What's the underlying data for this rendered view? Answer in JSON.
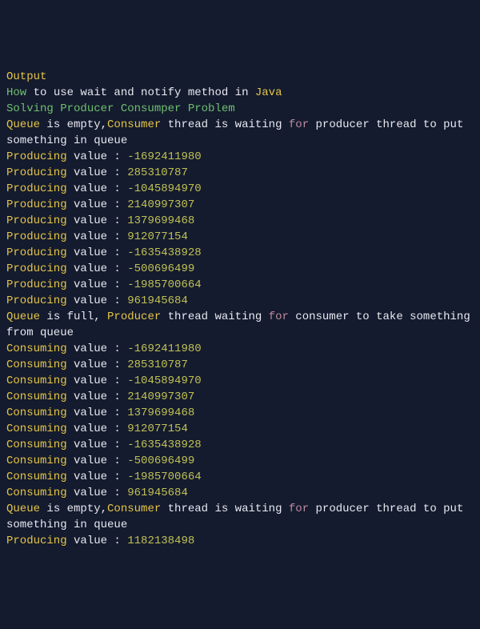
{
  "lines": [
    {
      "tokens": [
        {
          "t": "Output",
          "c": "kw"
        }
      ]
    },
    {
      "tokens": [
        {
          "t": "How",
          "c": "ty"
        },
        {
          "t": " to use wait and notify method in ",
          "c": "txt"
        },
        {
          "t": "Java",
          "c": "fn"
        }
      ]
    },
    {
      "tokens": [
        {
          "t": "Solving Producer Consumper Problem",
          "c": "ty"
        }
      ]
    },
    {
      "tokens": [
        {
          "t": "Queue",
          "c": "kw"
        },
        {
          "t": " is empty,",
          "c": "txt"
        },
        {
          "t": "Consumer",
          "c": "kw"
        },
        {
          "t": " thread is waiting ",
          "c": "txt"
        },
        {
          "t": "for",
          "c": "op"
        },
        {
          "t": " producer thread to put something in queue",
          "c": "txt"
        }
      ]
    },
    {
      "tokens": [
        {
          "t": "Producing",
          "c": "kw"
        },
        {
          "t": " value : ",
          "c": "txt"
        },
        {
          "t": "-1692411980",
          "c": "num"
        }
      ]
    },
    {
      "tokens": [
        {
          "t": "Producing",
          "c": "kw"
        },
        {
          "t": " value : ",
          "c": "txt"
        },
        {
          "t": "285310787",
          "c": "num"
        }
      ]
    },
    {
      "tokens": [
        {
          "t": "Producing",
          "c": "kw"
        },
        {
          "t": " value : ",
          "c": "txt"
        },
        {
          "t": "-1045894970",
          "c": "num"
        }
      ]
    },
    {
      "tokens": [
        {
          "t": "Producing",
          "c": "kw"
        },
        {
          "t": " value : ",
          "c": "txt"
        },
        {
          "t": "2140997307",
          "c": "num"
        }
      ]
    },
    {
      "tokens": [
        {
          "t": "Producing",
          "c": "kw"
        },
        {
          "t": " value : ",
          "c": "txt"
        },
        {
          "t": "1379699468",
          "c": "num"
        }
      ]
    },
    {
      "tokens": [
        {
          "t": "Producing",
          "c": "kw"
        },
        {
          "t": " value : ",
          "c": "txt"
        },
        {
          "t": "912077154",
          "c": "num"
        }
      ]
    },
    {
      "tokens": [
        {
          "t": "Producing",
          "c": "kw"
        },
        {
          "t": " value : ",
          "c": "txt"
        },
        {
          "t": "-1635438928",
          "c": "num"
        }
      ]
    },
    {
      "tokens": [
        {
          "t": "Producing",
          "c": "kw"
        },
        {
          "t": " value : ",
          "c": "txt"
        },
        {
          "t": "-500696499",
          "c": "num"
        }
      ]
    },
    {
      "tokens": [
        {
          "t": "Producing",
          "c": "kw"
        },
        {
          "t": " value : ",
          "c": "txt"
        },
        {
          "t": "-1985700664",
          "c": "num"
        }
      ]
    },
    {
      "tokens": [
        {
          "t": "Producing",
          "c": "kw"
        },
        {
          "t": " value : ",
          "c": "txt"
        },
        {
          "t": "961945684",
          "c": "num"
        }
      ]
    },
    {
      "tokens": [
        {
          "t": "Queue",
          "c": "kw"
        },
        {
          "t": " is full, ",
          "c": "txt"
        },
        {
          "t": "Producer",
          "c": "kw"
        },
        {
          "t": " thread waiting ",
          "c": "txt"
        },
        {
          "t": "for",
          "c": "op"
        },
        {
          "t": " consumer to take something from queue",
          "c": "txt"
        }
      ]
    },
    {
      "tokens": [
        {
          "t": "Consuming",
          "c": "kw"
        },
        {
          "t": " value : ",
          "c": "txt"
        },
        {
          "t": "-1692411980",
          "c": "num"
        }
      ]
    },
    {
      "tokens": [
        {
          "t": "Consuming",
          "c": "kw"
        },
        {
          "t": " value : ",
          "c": "txt"
        },
        {
          "t": "285310787",
          "c": "num"
        }
      ]
    },
    {
      "tokens": [
        {
          "t": "Consuming",
          "c": "kw"
        },
        {
          "t": " value : ",
          "c": "txt"
        },
        {
          "t": "-1045894970",
          "c": "num"
        }
      ]
    },
    {
      "tokens": [
        {
          "t": "Consuming",
          "c": "kw"
        },
        {
          "t": " value : ",
          "c": "txt"
        },
        {
          "t": "2140997307",
          "c": "num"
        }
      ]
    },
    {
      "tokens": [
        {
          "t": "Consuming",
          "c": "kw"
        },
        {
          "t": " value : ",
          "c": "txt"
        },
        {
          "t": "1379699468",
          "c": "num"
        }
      ]
    },
    {
      "tokens": [
        {
          "t": "Consuming",
          "c": "kw"
        },
        {
          "t": " value : ",
          "c": "txt"
        },
        {
          "t": "912077154",
          "c": "num"
        }
      ]
    },
    {
      "tokens": [
        {
          "t": "Consuming",
          "c": "kw"
        },
        {
          "t": " value : ",
          "c": "txt"
        },
        {
          "t": "-1635438928",
          "c": "num"
        }
      ]
    },
    {
      "tokens": [
        {
          "t": "Consuming",
          "c": "kw"
        },
        {
          "t": " value : ",
          "c": "txt"
        },
        {
          "t": "-500696499",
          "c": "num"
        }
      ]
    },
    {
      "tokens": [
        {
          "t": "Consuming",
          "c": "kw"
        },
        {
          "t": " value : ",
          "c": "txt"
        },
        {
          "t": "-1985700664",
          "c": "num"
        }
      ]
    },
    {
      "tokens": [
        {
          "t": "Consuming",
          "c": "kw"
        },
        {
          "t": " value : ",
          "c": "txt"
        },
        {
          "t": "961945684",
          "c": "num"
        }
      ]
    },
    {
      "tokens": [
        {
          "t": "Queue",
          "c": "kw"
        },
        {
          "t": " is empty,",
          "c": "txt"
        },
        {
          "t": "Consumer",
          "c": "kw"
        },
        {
          "t": " thread is waiting ",
          "c": "txt"
        },
        {
          "t": "for",
          "c": "op"
        },
        {
          "t": " producer thread to put something in queue",
          "c": "txt"
        }
      ]
    },
    {
      "tokens": [
        {
          "t": "Producing",
          "c": "kw"
        },
        {
          "t": " value : ",
          "c": "txt"
        },
        {
          "t": "1182138498",
          "c": "num"
        }
      ]
    }
  ]
}
